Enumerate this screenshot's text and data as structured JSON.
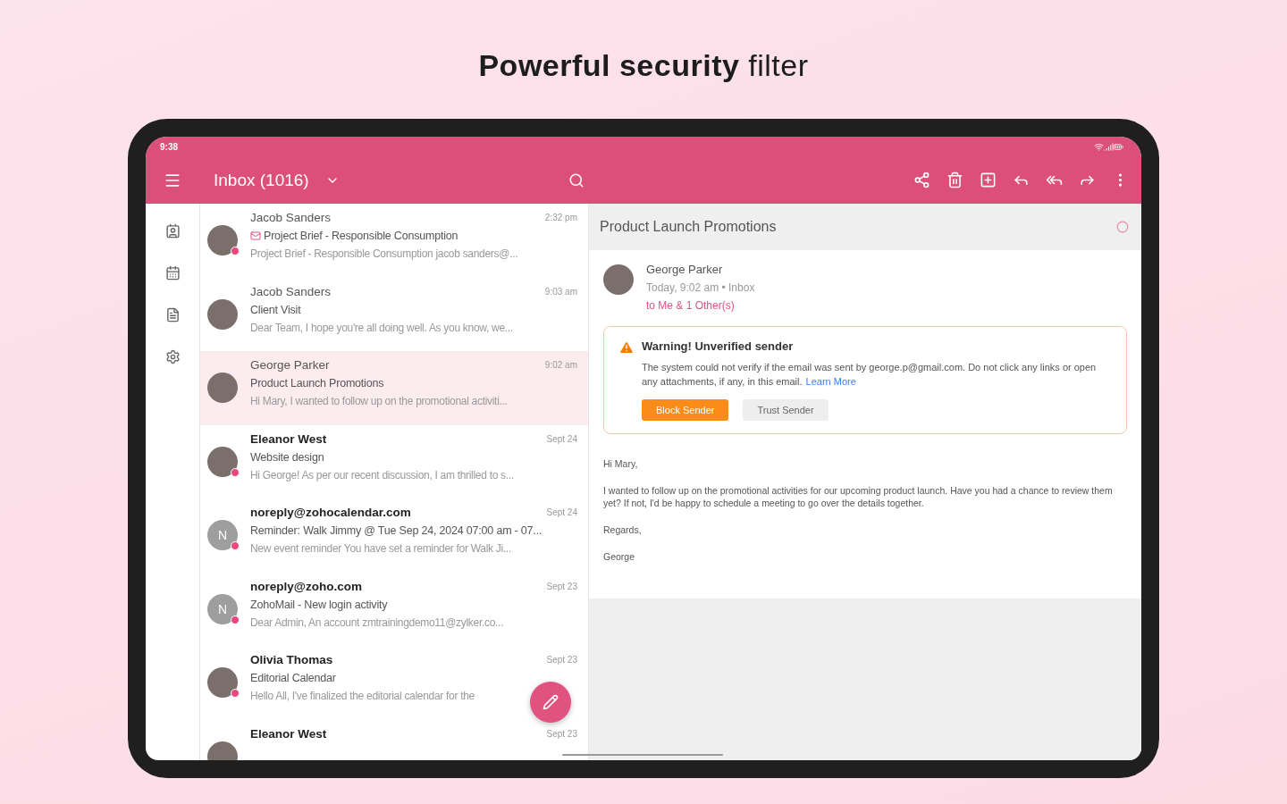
{
  "headline": "**Powerful security** filter",
  "status_bar": {
    "time": "9:38"
  },
  "toolbar": {
    "title": "Inbox (1016)"
  },
  "rail": [
    {
      "kind": "contacts"
    },
    {
      "kind": "calendar"
    },
    {
      "kind": "notes"
    },
    {
      "kind": "settings"
    }
  ],
  "emails": [
    {
      "sender": "Jacob Sanders",
      "time": "2:32 pm",
      "subject": "Project Brief - Responsible Consumption",
      "preview": "Project Brief - Responsible Consumption jacob sanders@...",
      "avatar": {
        "kind": "photo"
      },
      "unread": false,
      "status_dot": true,
      "subject_icon": true,
      "selected": false
    },
    {
      "sender": "Jacob Sanders",
      "time": "9:03 am",
      "subject": "Client Visit",
      "preview": "Dear Team, I hope you're all doing well. As you know, we...",
      "avatar": {
        "kind": "photo"
      },
      "unread": false,
      "status_dot": false,
      "subject_icon": false,
      "selected": false
    },
    {
      "sender": "George Parker",
      "time": "9:02 am",
      "subject": "Product Launch Promotions",
      "preview": "Hi Mary, I wanted to follow up on the promotional activiti...",
      "avatar": {
        "kind": "photo"
      },
      "unread": false,
      "status_dot": false,
      "subject_icon": false,
      "selected": true
    },
    {
      "sender": "Eleanor West",
      "time": "Sept 24",
      "subject": "Website design",
      "preview": "Hi George! As per our recent discussion, I am thrilled to s...",
      "avatar": {
        "kind": "photo"
      },
      "unread": true,
      "status_dot": true,
      "subject_icon": false,
      "selected": false
    },
    {
      "sender": "noreply@zohocalendar.com",
      "time": "Sept 24",
      "subject": "Reminder: Walk Jimmy @ Tue Sep 24, 2024 07:00 am - 07...",
      "preview": "New event reminder You have set a reminder for Walk Ji...",
      "avatar": {
        "kind": "letter",
        "letter": "N"
      },
      "unread": true,
      "status_dot": true,
      "subject_icon": false,
      "selected": false
    },
    {
      "sender": "noreply@zoho.com",
      "time": "Sept 23",
      "subject": "ZohoMail - New login activity",
      "preview": "Dear Admin, An account zmtrainingdemo11@zylker.co...",
      "avatar": {
        "kind": "letter",
        "letter": "N"
      },
      "unread": true,
      "status_dot": true,
      "subject_icon": false,
      "selected": false
    },
    {
      "sender": "Olivia Thomas",
      "time": "Sept 23",
      "subject": "Editorial Calendar",
      "preview": "Hello All, I've finalized the editorial calendar for the",
      "avatar": {
        "kind": "photo"
      },
      "unread": true,
      "status_dot": true,
      "subject_icon": false,
      "selected": false
    },
    {
      "sender": "Eleanor West",
      "time": "Sept 23",
      "avatar": {
        "kind": "photo"
      },
      "unread": true,
      "status_dot": false,
      "subject_icon": false,
      "selected": false
    }
  ],
  "reader": {
    "subject": "Product Launch Promotions",
    "sender": "George Parker",
    "meta": "Today, 9:02 am • Inbox",
    "recipients": "to Me & 1 Other(s)",
    "warning": {
      "title": "Warning! Unverified sender",
      "text": "The system could not verify if the email was sent by george.p@gmail.com. Do not click any links or open any attachments, if any, in this email.",
      "link": "Learn More",
      "buttons": [
        {
          "label": "Block Sender",
          "kind": "primary"
        },
        {
          "label": "Trust Sender",
          "kind": "secondary"
        }
      ]
    },
    "body": [
      "Hi Mary,",
      "I wanted to follow up on the promotional activities for our upcoming product launch. Have you had a chance to review them yet? If not, I'd be happy to schedule a meeting to go over the details together.",
      "Regards,",
      "George"
    ]
  }
}
